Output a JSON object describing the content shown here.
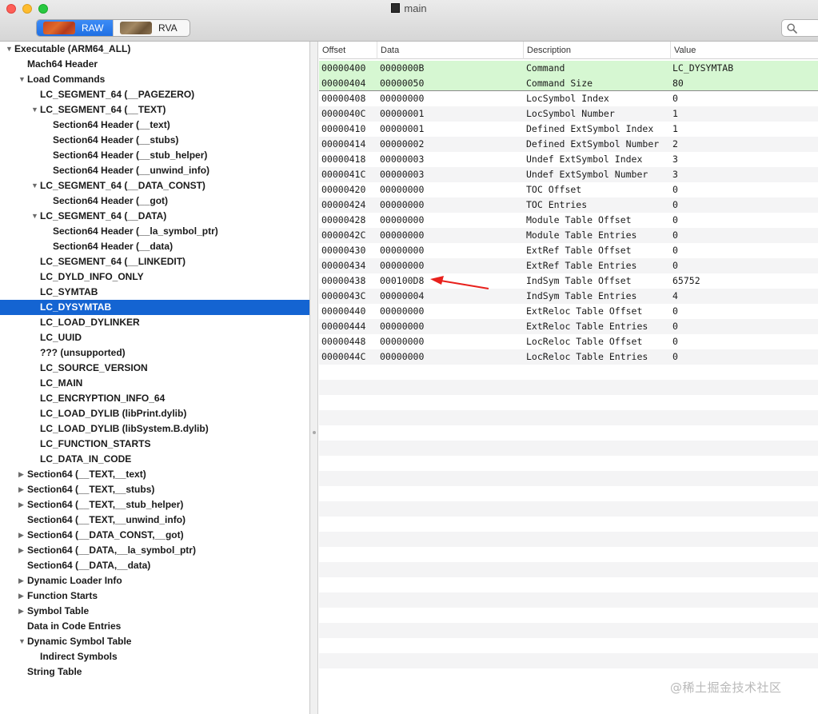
{
  "window": {
    "title": "main"
  },
  "toolbar": {
    "modes": [
      {
        "label": "RAW",
        "active": true
      },
      {
        "label": "RVA",
        "active": false
      }
    ]
  },
  "colors": {
    "selection": "#1464d2",
    "highlight_row": "#d6f7d2",
    "arrow": "#e8201c"
  },
  "sidebar": {
    "items": [
      {
        "label": "Executable  (ARM64_ALL)",
        "level": 0,
        "disclosure": "expanded"
      },
      {
        "label": "Mach64 Header",
        "level": 1,
        "disclosure": "none"
      },
      {
        "label": "Load Commands",
        "level": 1,
        "disclosure": "expanded"
      },
      {
        "label": "LC_SEGMENT_64 (__PAGEZERO)",
        "level": 2,
        "disclosure": "none"
      },
      {
        "label": "LC_SEGMENT_64 (__TEXT)",
        "level": 2,
        "disclosure": "expanded"
      },
      {
        "label": "Section64 Header (__text)",
        "level": 3,
        "disclosure": "none"
      },
      {
        "label": "Section64 Header (__stubs)",
        "level": 3,
        "disclosure": "none"
      },
      {
        "label": "Section64 Header (__stub_helper)",
        "level": 3,
        "disclosure": "none"
      },
      {
        "label": "Section64 Header (__unwind_info)",
        "level": 3,
        "disclosure": "none"
      },
      {
        "label": "LC_SEGMENT_64 (__DATA_CONST)",
        "level": 2,
        "disclosure": "expanded"
      },
      {
        "label": "Section64 Header (__got)",
        "level": 3,
        "disclosure": "none"
      },
      {
        "label": "LC_SEGMENT_64 (__DATA)",
        "level": 2,
        "disclosure": "expanded"
      },
      {
        "label": "Section64 Header (__la_symbol_ptr)",
        "level": 3,
        "disclosure": "none"
      },
      {
        "label": "Section64 Header (__data)",
        "level": 3,
        "disclosure": "none"
      },
      {
        "label": "LC_SEGMENT_64 (__LINKEDIT)",
        "level": 2,
        "disclosure": "none"
      },
      {
        "label": "LC_DYLD_INFO_ONLY",
        "level": 2,
        "disclosure": "none"
      },
      {
        "label": "LC_SYMTAB",
        "level": 2,
        "disclosure": "none"
      },
      {
        "label": "LC_DYSYMTAB",
        "level": 2,
        "disclosure": "none",
        "selected": true
      },
      {
        "label": "LC_LOAD_DYLINKER",
        "level": 2,
        "disclosure": "none"
      },
      {
        "label": "LC_UUID",
        "level": 2,
        "disclosure": "none"
      },
      {
        "label": "??? (unsupported)",
        "level": 2,
        "disclosure": "none"
      },
      {
        "label": "LC_SOURCE_VERSION",
        "level": 2,
        "disclosure": "none"
      },
      {
        "label": "LC_MAIN",
        "level": 2,
        "disclosure": "none"
      },
      {
        "label": "LC_ENCRYPTION_INFO_64",
        "level": 2,
        "disclosure": "none"
      },
      {
        "label": "LC_LOAD_DYLIB (libPrint.dylib)",
        "level": 2,
        "disclosure": "none"
      },
      {
        "label": "LC_LOAD_DYLIB (libSystem.B.dylib)",
        "level": 2,
        "disclosure": "none"
      },
      {
        "label": "LC_FUNCTION_STARTS",
        "level": 2,
        "disclosure": "none"
      },
      {
        "label": "LC_DATA_IN_CODE",
        "level": 2,
        "disclosure": "none"
      },
      {
        "label": "Section64 (__TEXT,__text)",
        "level": 1,
        "disclosure": "collapsed"
      },
      {
        "label": "Section64 (__TEXT,__stubs)",
        "level": 1,
        "disclosure": "collapsed"
      },
      {
        "label": "Section64 (__TEXT,__stub_helper)",
        "level": 1,
        "disclosure": "collapsed"
      },
      {
        "label": "Section64 (__TEXT,__unwind_info)",
        "level": 1,
        "disclosure": "none"
      },
      {
        "label": "Section64 (__DATA_CONST,__got)",
        "level": 1,
        "disclosure": "collapsed"
      },
      {
        "label": "Section64 (__DATA,__la_symbol_ptr)",
        "level": 1,
        "disclosure": "collapsed"
      },
      {
        "label": "Section64 (__DATA,__data)",
        "level": 1,
        "disclosure": "none"
      },
      {
        "label": "Dynamic Loader Info",
        "level": 1,
        "disclosure": "collapsed"
      },
      {
        "label": "Function Starts",
        "level": 1,
        "disclosure": "collapsed"
      },
      {
        "label": "Symbol Table",
        "level": 1,
        "disclosure": "collapsed"
      },
      {
        "label": "Data in Code Entries",
        "level": 1,
        "disclosure": "none"
      },
      {
        "label": "Dynamic Symbol Table",
        "level": 1,
        "disclosure": "expanded"
      },
      {
        "label": "Indirect Symbols",
        "level": 2,
        "disclosure": "none"
      },
      {
        "label": "String Table",
        "level": 1,
        "disclosure": "none"
      }
    ]
  },
  "table": {
    "columns": [
      "Offset",
      "Data",
      "Description",
      "Value"
    ],
    "rows": [
      {
        "offset": "00000400",
        "data": "0000000B",
        "description": "Command",
        "value": "LC_DYSYMTAB",
        "highlight": true
      },
      {
        "offset": "00000404",
        "data": "00000050",
        "description": "Command Size",
        "value": "80",
        "highlight": true
      },
      {
        "offset": "00000408",
        "data": "00000000",
        "description": "LocSymbol Index",
        "value": "0"
      },
      {
        "offset": "0000040C",
        "data": "00000001",
        "description": "LocSymbol Number",
        "value": "1"
      },
      {
        "offset": "00000410",
        "data": "00000001",
        "description": "Defined ExtSymbol Index",
        "value": "1"
      },
      {
        "offset": "00000414",
        "data": "00000002",
        "description": "Defined ExtSymbol Number",
        "value": "2"
      },
      {
        "offset": "00000418",
        "data": "00000003",
        "description": "Undef ExtSymbol Index",
        "value": "3"
      },
      {
        "offset": "0000041C",
        "data": "00000003",
        "description": "Undef ExtSymbol Number",
        "value": "3"
      },
      {
        "offset": "00000420",
        "data": "00000000",
        "description": "TOC Offset",
        "value": "0"
      },
      {
        "offset": "00000424",
        "data": "00000000",
        "description": "TOC Entries",
        "value": "0"
      },
      {
        "offset": "00000428",
        "data": "00000000",
        "description": "Module Table Offset",
        "value": "0"
      },
      {
        "offset": "0000042C",
        "data": "00000000",
        "description": "Module Table Entries",
        "value": "0"
      },
      {
        "offset": "00000430",
        "data": "00000000",
        "description": "ExtRef Table Offset",
        "value": "0"
      },
      {
        "offset": "00000434",
        "data": "00000000",
        "description": "ExtRef Table Entries",
        "value": "0"
      },
      {
        "offset": "00000438",
        "data": "000100D8",
        "description": "IndSym Table Offset",
        "value": "65752",
        "annotated": true
      },
      {
        "offset": "0000043C",
        "data": "00000004",
        "description": "IndSym Table Entries",
        "value": "4"
      },
      {
        "offset": "00000440",
        "data": "00000000",
        "description": "ExtReloc Table Offset",
        "value": "0"
      },
      {
        "offset": "00000444",
        "data": "00000000",
        "description": "ExtReloc Table Entries",
        "value": "0"
      },
      {
        "offset": "00000448",
        "data": "00000000",
        "description": "LocReloc Table Offset",
        "value": "0"
      },
      {
        "offset": "0000044C",
        "data": "00000000",
        "description": "LocReloc Table Entries",
        "value": "0"
      }
    ]
  },
  "watermark": "@稀土掘金技术社区"
}
